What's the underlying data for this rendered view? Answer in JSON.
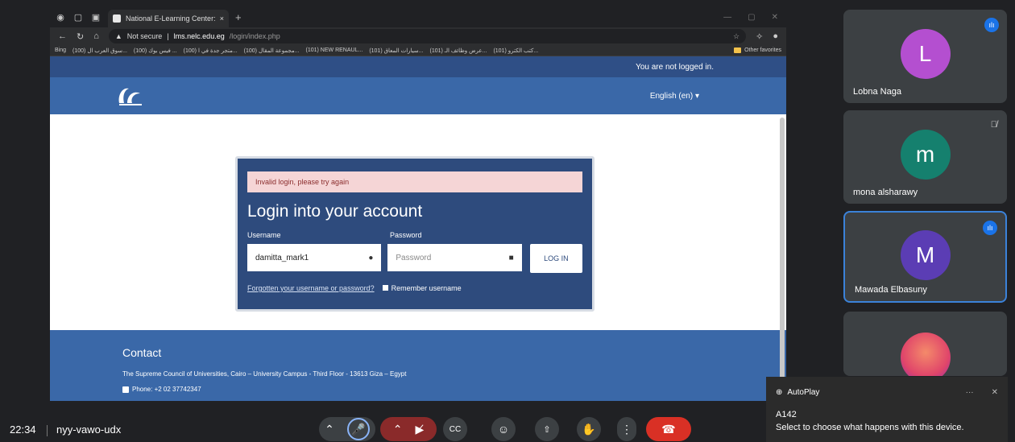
{
  "browser": {
    "tab_title": "National E-Learning Center: Log i",
    "address": {
      "security": "Not secure",
      "host": "lms.nelc.edu.eg",
      "path": "/login/index.php"
    },
    "bookmarks": [
      "Bing",
      "(100) سوق العرب ال...",
      "(100) فيس بوك ...",
      "(100) متجر جدة في ا...",
      "(100) مجموعة المقال...",
      "(101) NEW RENAUL...",
      "(101) سيارات المعاق...",
      "(101) عرض وظائف الـ...",
      "(101) كتب الكترو..."
    ],
    "other_favorites": "Other favorites"
  },
  "site": {
    "not_logged_in": "You are not logged in.",
    "language": "English (en) ▾",
    "alert": "Invalid login, please try again",
    "heading": "Login into your account",
    "username_label": "Username",
    "password_label": "Password",
    "username_value": "damitta_mark1",
    "password_placeholder": "Password",
    "login_button": "LOG IN",
    "forgot_link": "Forgotten your username or password?",
    "remember": "Remember username",
    "contact_heading": "Contact",
    "address": "The Supreme Council of Universities, Cairo – University Campus - Third Floor - 13613 Giza – Egypt",
    "phone": "Phone: +2 02 37742347"
  },
  "participants": [
    {
      "name": "Lobna Naga",
      "initial": "L",
      "color": "#b44fd0",
      "speaking": true
    },
    {
      "name": "mona alsharawy",
      "initial": "m",
      "color": "#15806e",
      "speaking": false
    },
    {
      "name": "Mawada Elbasuny",
      "initial": "M",
      "color": "#5b3db4",
      "speaking": true
    },
    {
      "name": "",
      "initial": "",
      "color": "#e0456a",
      "speaking": false
    }
  ],
  "meeting": {
    "time": "22:34",
    "code": "nyy-vawo-udx"
  },
  "toast": {
    "app": "AutoPlay",
    "title": "A142",
    "message": "Select to choose what happens with this device."
  }
}
